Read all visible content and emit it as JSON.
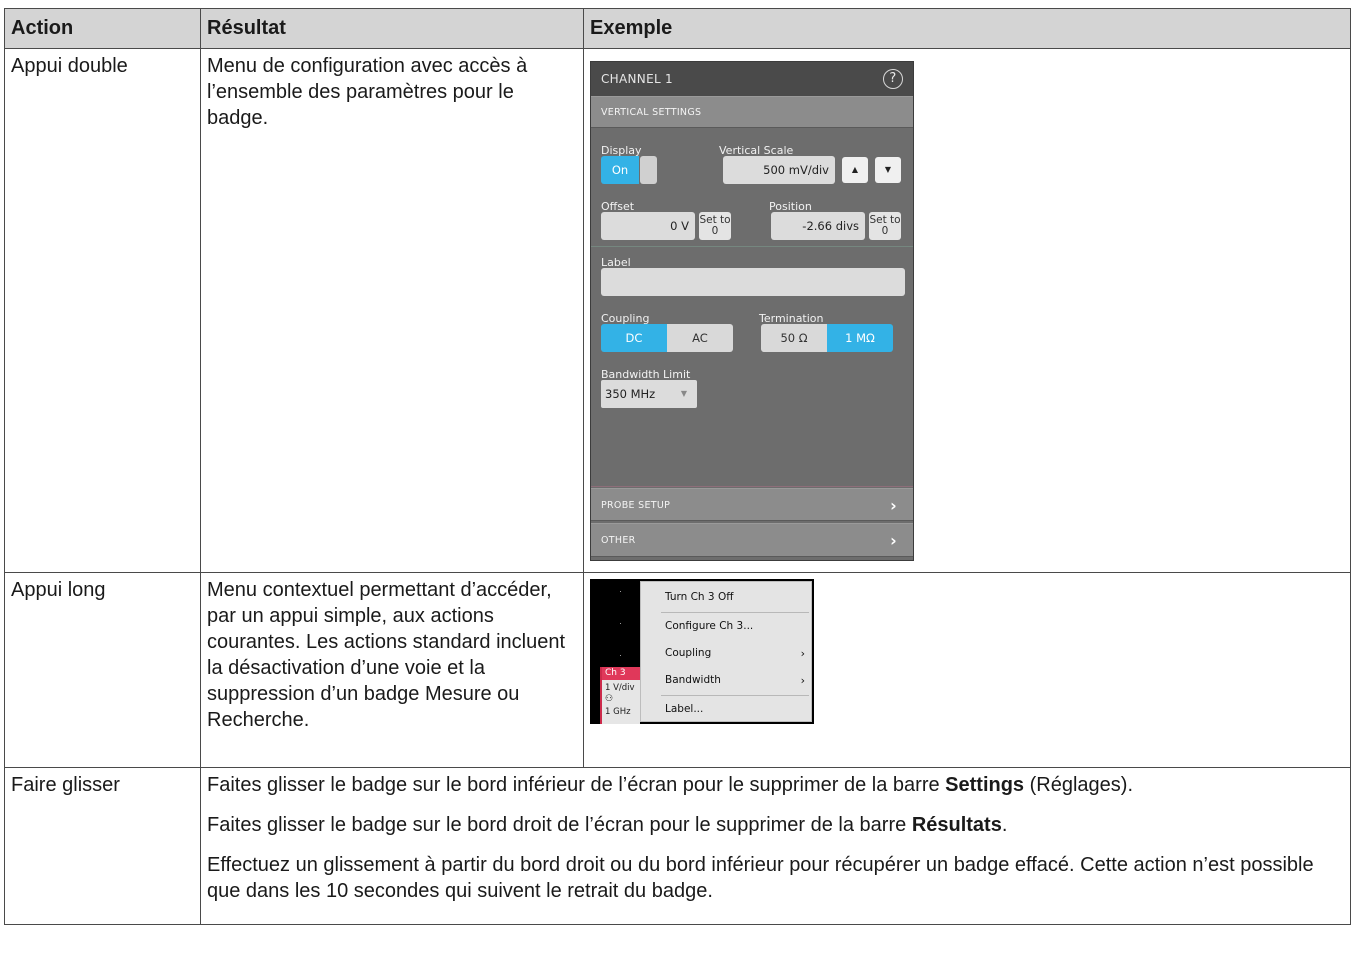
{
  "table": {
    "headers": [
      "Action",
      "Résultat",
      "Exemple"
    ],
    "rows": [
      {
        "action": "Appui double",
        "result": "Menu de configuration avec accès à l’ensemble des paramètres pour le badge."
      },
      {
        "action": "Appui long",
        "result": "Menu contextuel permettant d’accéder, par un appui simple, aux actions courantes. Les actions standard incluent la désactivation d’une voie et la suppression d’un badge Mesure ou Recherche."
      },
      {
        "action": "Faire glisser",
        "p1_before": "Faites glisser le badge sur le bord inférieur de l’écran pour le supprimer de la barre ",
        "p1_bold": "Settings",
        "p1_after": " (Réglages).",
        "p2_before": "Faites glisser le badge sur le bord droit de l’écran pour le supprimer de la barre ",
        "p2_bold": "Résultats",
        "p2_after": ".",
        "p3": "Effectuez un glissement à partir du bord droit ou du bord inférieur pour récupérer un badge effacé. Cette action n’est possible que dans les 10 secondes qui suivent le retrait du badge."
      }
    ]
  },
  "channel_panel": {
    "title": "CHANNEL 1",
    "help_glyph": "?",
    "section_vertical": "VERTICAL SETTINGS",
    "display_label": "Display",
    "display_value": "On",
    "vscale_label": "Vertical Scale",
    "vscale_value": "500 mV/div",
    "offset_label": "Offset",
    "offset_value": "0 V",
    "position_label": "Position",
    "position_value": "-2.66 divs",
    "set_to_0": "Set to 0",
    "label_label": "Label",
    "coupling_label": "Coupling",
    "coupling_dc": "DC",
    "coupling_ac": "AC",
    "termination_label": "Termination",
    "term_50": "50 Ω",
    "term_1m": "1 MΩ",
    "bw_label": "Bandwidth Limit",
    "bw_value": "350 MHz",
    "probe_setup": "PROBE SETUP",
    "other": "OTHER",
    "accent": "#33b2e6"
  },
  "context_menu": {
    "items": [
      "Turn Ch 3 Off",
      "Configure Ch 3...",
      "Coupling",
      "Bandwidth",
      "Label..."
    ],
    "badge": {
      "name": "Ch 3",
      "scale": "1 V/div",
      "bw": "1 GHz"
    },
    "badge_color": "#e0385a"
  }
}
